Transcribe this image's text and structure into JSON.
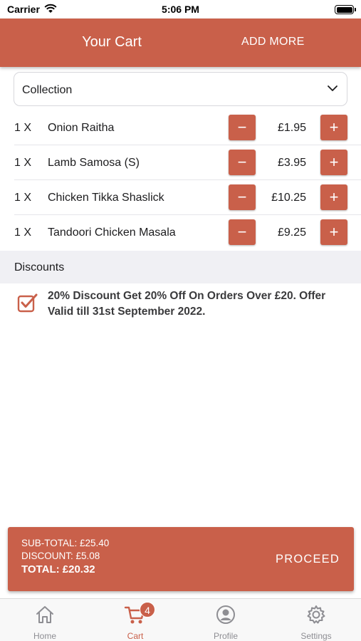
{
  "status_bar": {
    "carrier": "Carrier",
    "time": "5:06 PM"
  },
  "header": {
    "title": "Your Cart",
    "add_more_label": "ADD MORE"
  },
  "order_type": {
    "selected": "Collection"
  },
  "cart_items": [
    {
      "qty": "1 X",
      "name": "Onion Raitha",
      "price": "£1.95"
    },
    {
      "qty": "1 X",
      "name": "Lamb Samosa (S)",
      "price": "£3.95"
    },
    {
      "qty": "1 X",
      "name": "Chicken Tikka Shaslick",
      "price": "£10.25"
    },
    {
      "qty": "1 X",
      "name": "Tandoori Chicken Masala",
      "price": "£9.25"
    }
  ],
  "buttons": {
    "minus": "−",
    "plus": "+"
  },
  "discounts": {
    "header": "Discounts",
    "items": [
      {
        "checked": true,
        "text": "20% Discount Get 20% Off On Orders Over £20. Offer Valid till 31st September 2022."
      }
    ]
  },
  "summary": {
    "subtotal": "SUB-TOTAL: £25.40",
    "discount": "DISCOUNT: £5.08",
    "total": "TOTAL: £20.32",
    "proceed_label": "PROCEED"
  },
  "tabs": [
    {
      "label": "Home",
      "icon": "home-icon",
      "active": false
    },
    {
      "label": "Cart",
      "icon": "cart-icon",
      "active": true,
      "badge": "4"
    },
    {
      "label": "Profile",
      "icon": "profile-icon",
      "active": false
    },
    {
      "label": "Settings",
      "icon": "gear-icon",
      "active": false
    }
  ],
  "colors": {
    "accent": "#c9604a",
    "tab_inactive": "#8e8e93",
    "section_bg": "#f0f0f4"
  }
}
